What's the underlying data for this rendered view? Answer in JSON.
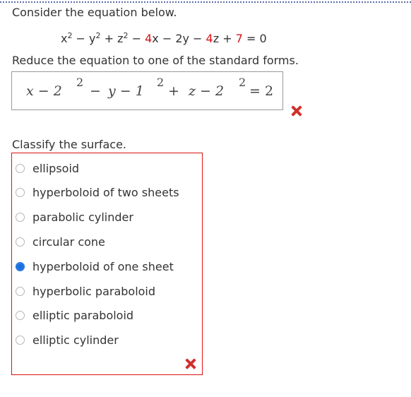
{
  "question": {
    "intro": "Consider the equation below.",
    "equation": {
      "part1": "x",
      "exp1": "2",
      "part2": " − y",
      "exp2": "2",
      "part3": " + z",
      "exp3": "2",
      "part4": " − ",
      "c1": "4",
      "part5": "x − 2y − ",
      "c2": "4",
      "part6": "z + ",
      "c3": "7",
      "part7": " = 0"
    },
    "reduce_prompt": "Reduce the equation to one of the standard forms.",
    "answer_math": {
      "t1": "x − 2",
      "e1": "2",
      "op1": "−",
      "t2": "y − 1",
      "e2": "2",
      "op2": "+",
      "t3": "z − 2",
      "e3": "2",
      "rhs": "= 2"
    },
    "classify_prompt": "Classify the surface.",
    "options": [
      {
        "label": "ellipsoid",
        "selected": false
      },
      {
        "label": "hyperboloid of two sheets",
        "selected": false
      },
      {
        "label": "parabolic cylinder",
        "selected": false
      },
      {
        "label": "circular cone",
        "selected": false
      },
      {
        "label": "hyperboloid of one sheet",
        "selected": true
      },
      {
        "label": "hyperbolic paraboloid",
        "selected": false
      },
      {
        "label": "elliptic paraboloid",
        "selected": false
      },
      {
        "label": "elliptic cylinder",
        "selected": false
      }
    ]
  },
  "status": {
    "equation_result": "incorrect",
    "classification_result": "incorrect",
    "incorrect_icon": "x-mark-icon",
    "incorrect_color": "#d0312d",
    "selected_color": "#1a6fe0"
  }
}
